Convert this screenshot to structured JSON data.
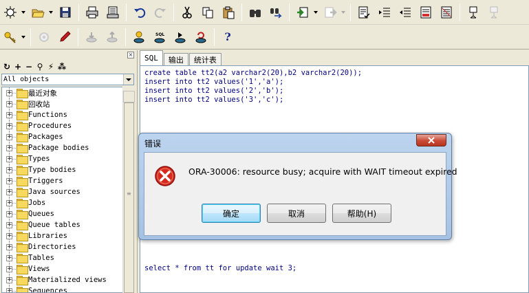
{
  "toolbar1": {
    "icons": [
      "new-icon",
      "open-icon",
      "save-icon",
      "print-icon",
      "print-preview-icon",
      "undo-icon",
      "redo-icon",
      "cut-icon",
      "copy-icon",
      "paste-icon",
      "find-icon",
      "find-next-icon",
      "import-icon",
      "export-icon",
      "explain-icon",
      "indent-icon",
      "unindent-icon",
      "comment-icon",
      "uncomment-icon",
      "window-icon",
      "window-disabled-icon"
    ]
  },
  "toolbar2": {
    "icons": [
      "key-icon",
      "sync-icon",
      "debug-icon",
      "db-down-icon",
      "db-up-icon",
      "db-connect-icon",
      "sql-window-icon",
      "db-run-icon",
      "db-refresh-icon",
      "help-icon"
    ],
    "help_label": "?",
    "sql_label": "SQL"
  },
  "browser": {
    "close_label": "×",
    "tools": [
      "↻",
      "+",
      "−",
      "⚲",
      "⚡",
      "⁂"
    ],
    "filter": "All objects",
    "tree": [
      "最近对象",
      "回收站",
      "Functions",
      "Procedures",
      "Packages",
      "Package bodies",
      "Types",
      "Type bodies",
      "Triggers",
      "Java sources",
      "Jobs",
      "Queues",
      "Queue tables",
      "Libraries",
      "Directories",
      "Tables",
      "Views",
      "Materialized views",
      "Sequences"
    ]
  },
  "editor": {
    "tabs": [
      "SQL",
      "输出",
      "统计表"
    ],
    "code": [
      "create table tt2(a2 varchar2(20),b2 varchar2(20));",
      "insert into tt2 values('1','a');",
      "insert into tt2 values('2','b');",
      "insert into tt2 values('3','c');"
    ],
    "code_bottom": "select * from tt for update wait 3;"
  },
  "dialog": {
    "title": "错误",
    "message": "ORA-30006: resource busy; acquire with WAIT timeout expired",
    "buttons": {
      "ok": "确定",
      "cancel": "取消",
      "help": "帮助(H)"
    }
  }
}
